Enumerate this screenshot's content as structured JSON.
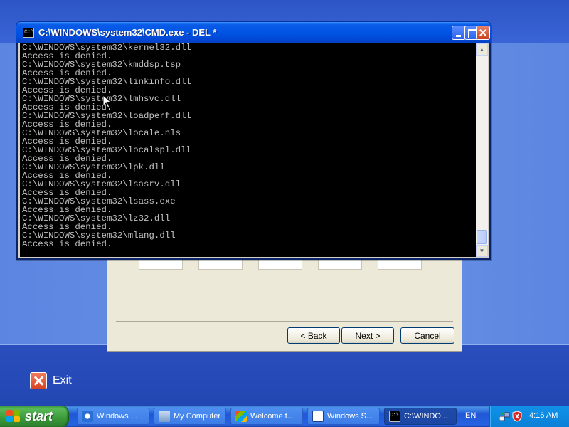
{
  "cmd_window": {
    "title": "C:\\WINDOWS\\system32\\CMD.exe - DEL *",
    "lines": [
      "C:\\WINDOWS\\system32\\kernel32.dll",
      "Access is denied.",
      "C:\\WINDOWS\\system32\\kmddsp.tsp",
      "Access is denied.",
      "C:\\WINDOWS\\system32\\linkinfo.dll",
      "Access is denied.",
      "C:\\WINDOWS\\system32\\lmhsvc.dll",
      "Access is denied.",
      "C:\\WINDOWS\\system32\\loadperf.dll",
      "Access is denied.",
      "C:\\WINDOWS\\system32\\locale.nls",
      "Access is denied.",
      "C:\\WINDOWS\\system32\\localspl.dll",
      "Access is denied.",
      "C:\\WINDOWS\\system32\\lpk.dll",
      "Access is denied.",
      "C:\\WINDOWS\\system32\\lsasrv.dll",
      "Access is denied.",
      "C:\\WINDOWS\\system32\\lsass.exe",
      "Access is denied.",
      "C:\\WINDOWS\\system32\\lz32.dll",
      "Access is denied.",
      "C:\\WINDOWS\\system32\\mlang.dll",
      "Access is denied."
    ]
  },
  "wizard": {
    "back_label": "< Back",
    "next_label": "Next >",
    "cancel_label": "Cancel"
  },
  "exit": {
    "label": "Exit"
  },
  "taskbar": {
    "start_label": "start",
    "tasks": [
      {
        "label": "Windows ...",
        "icon": "windows-update-icon"
      },
      {
        "label": "My Computer",
        "icon": "my-computer-icon"
      },
      {
        "label": "Welcome t...",
        "icon": "welcome-icon"
      },
      {
        "label": "Windows S...",
        "icon": "window-icon"
      },
      {
        "label": "C:\\WINDO...",
        "icon": "cmd-icon"
      }
    ],
    "language": "EN",
    "clock": "4:16 AM"
  },
  "colors": {
    "console_bg": "#000000",
    "console_text": "#c0c0c0",
    "titlebar": "#0054e3",
    "start_green": "#3a9a3a",
    "taskbar_blue": "#2157d7"
  }
}
